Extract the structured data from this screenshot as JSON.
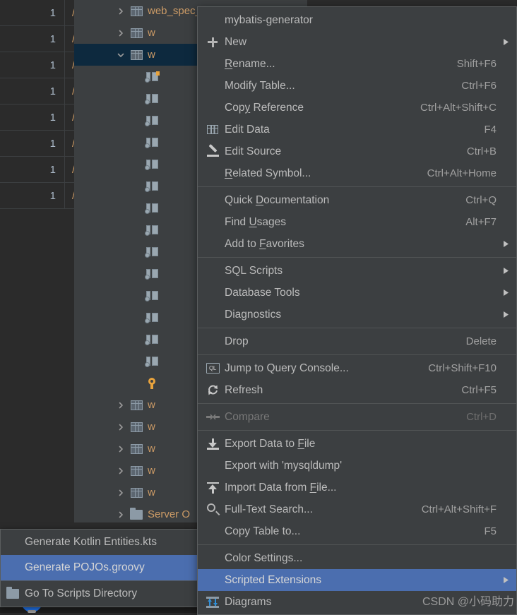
{
  "app": {
    "theme_bg": "#3c3f41",
    "editor_bg": "#2b2b2b",
    "highlight_blue": "#4b6eaf",
    "tree_selection_blue": "#0d293e",
    "text_color": "#bbbbbb",
    "accent_orange": "#cc9b66"
  },
  "grid": {
    "rows": [
      {
        "num": "1",
        "path": "/g"
      },
      {
        "num": "1",
        "path": "/m"
      },
      {
        "num": "1",
        "path": "/m"
      },
      {
        "num": "1",
        "path": "/m"
      },
      {
        "num": "1",
        "path": "/m"
      },
      {
        "num": "1",
        "path": "/m"
      },
      {
        "num": "1",
        "path": "/m"
      },
      {
        "num": "1",
        "path": "/m"
      }
    ]
  },
  "tree": {
    "rows": [
      {
        "indent": 0,
        "chevron": "right",
        "icon": "table-icon",
        "label": "web_spec_model"
      },
      {
        "indent": 0,
        "chevron": "right",
        "icon": "table-icon",
        "label": "w"
      },
      {
        "indent": 0,
        "chevron": "down",
        "icon": "table-icon",
        "label": "w",
        "selected": true
      },
      {
        "indent": 1,
        "chevron": "none",
        "icon": "column-pk-icon",
        "label": ""
      },
      {
        "indent": 1,
        "chevron": "none",
        "icon": "column-icon",
        "label": ""
      },
      {
        "indent": 1,
        "chevron": "none",
        "icon": "column-icon",
        "label": ""
      },
      {
        "indent": 1,
        "chevron": "none",
        "icon": "column-icon",
        "label": ""
      },
      {
        "indent": 1,
        "chevron": "none",
        "icon": "column-icon",
        "label": ""
      },
      {
        "indent": 1,
        "chevron": "none",
        "icon": "column-icon",
        "label": ""
      },
      {
        "indent": 1,
        "chevron": "none",
        "icon": "column-icon",
        "label": ""
      },
      {
        "indent": 1,
        "chevron": "none",
        "icon": "column-icon",
        "label": ""
      },
      {
        "indent": 1,
        "chevron": "none",
        "icon": "column-icon",
        "label": ""
      },
      {
        "indent": 1,
        "chevron": "none",
        "icon": "column-icon",
        "label": ""
      },
      {
        "indent": 1,
        "chevron": "none",
        "icon": "column-icon",
        "label": ""
      },
      {
        "indent": 1,
        "chevron": "none",
        "icon": "column-icon",
        "label": ""
      },
      {
        "indent": 1,
        "chevron": "none",
        "icon": "column-icon",
        "label": ""
      },
      {
        "indent": 1,
        "chevron": "none",
        "icon": "column-icon",
        "label": ""
      },
      {
        "indent": 1,
        "chevron": "none",
        "icon": "key-icon",
        "label": ""
      },
      {
        "indent": 0,
        "chevron": "right",
        "icon": "table-icon",
        "label": "w"
      },
      {
        "indent": 0,
        "chevron": "right",
        "icon": "table-icon",
        "label": "w"
      },
      {
        "indent": 0,
        "chevron": "right",
        "icon": "table-icon",
        "label": "w"
      },
      {
        "indent": 0,
        "chevron": "right",
        "icon": "table-icon",
        "label": "w"
      },
      {
        "indent": 0,
        "chevron": "right",
        "icon": "table-icon",
        "label": "w"
      },
      {
        "indent": 0,
        "chevron": "right",
        "icon": "folder-icon",
        "label": "Server O"
      }
    ]
  },
  "context_menu": {
    "items": [
      {
        "id": "mybatis-generator",
        "label": "mybatis-generator",
        "icon": "",
        "shortcut": "",
        "submenu": false
      },
      {
        "id": "new",
        "label": "New",
        "icon": "plus-icon",
        "shortcut": "",
        "submenu": true
      },
      {
        "id": "rename",
        "label": "Rename...",
        "icon": "",
        "shortcut": "Shift+F6",
        "mnemonic": "R",
        "submenu": false
      },
      {
        "id": "modify-table",
        "label": "Modify Table...",
        "icon": "",
        "shortcut": "Ctrl+F6",
        "submenu": false
      },
      {
        "id": "copy-reference",
        "label": "Copy Reference",
        "icon": "",
        "shortcut": "Ctrl+Alt+Shift+C",
        "mnemonic": "y",
        "submenu": false
      },
      {
        "id": "edit-data",
        "label": "Edit Data",
        "icon": "grid-icon",
        "shortcut": "F4",
        "submenu": false
      },
      {
        "id": "edit-source",
        "label": "Edit Source",
        "icon": "pencil-icon",
        "shortcut": "Ctrl+B",
        "submenu": false
      },
      {
        "id": "related-symbol",
        "label": "Related Symbol...",
        "icon": "",
        "shortcut": "Ctrl+Alt+Home",
        "mnemonic": "R",
        "submenu": false
      },
      {
        "id": "separator-1",
        "separator": true
      },
      {
        "id": "quick-documentation",
        "label": "Quick Documentation",
        "icon": "",
        "shortcut": "Ctrl+Q",
        "mnemonic": "D",
        "submenu": false
      },
      {
        "id": "find-usages",
        "label": "Find Usages",
        "icon": "",
        "shortcut": "Alt+F7",
        "mnemonic": "U",
        "submenu": false
      },
      {
        "id": "add-to-favorites",
        "label": "Add to Favorites",
        "icon": "",
        "shortcut": "",
        "mnemonic": "F",
        "submenu": true
      },
      {
        "id": "separator-2",
        "separator": true
      },
      {
        "id": "sql-scripts",
        "label": "SQL Scripts",
        "icon": "",
        "shortcut": "",
        "submenu": true
      },
      {
        "id": "database-tools",
        "label": "Database Tools",
        "icon": "",
        "shortcut": "",
        "submenu": true
      },
      {
        "id": "diagnostics",
        "label": "Diagnostics",
        "icon": "",
        "shortcut": "",
        "submenu": true
      },
      {
        "id": "separator-3",
        "separator": true
      },
      {
        "id": "drop",
        "label": "Drop",
        "icon": "",
        "shortcut": "Delete",
        "submenu": false
      },
      {
        "id": "separator-4",
        "separator": true
      },
      {
        "id": "jump-to-query-console",
        "label": "Jump to Query Console...",
        "icon": "ql-icon",
        "shortcut": "Ctrl+Shift+F10",
        "submenu": false
      },
      {
        "id": "refresh",
        "label": "Refresh",
        "icon": "refresh-icon",
        "shortcut": "Ctrl+F5",
        "submenu": false
      },
      {
        "id": "separator-5",
        "separator": true
      },
      {
        "id": "compare",
        "label": "Compare",
        "icon": "compare-icon",
        "shortcut": "Ctrl+D",
        "submenu": false,
        "disabled": true
      },
      {
        "id": "separator-6",
        "separator": true
      },
      {
        "id": "export-data-to-file",
        "label": "Export Data to File",
        "icon": "download-icon",
        "shortcut": "",
        "mnemonic": "F",
        "submenu": false
      },
      {
        "id": "export-with-mysqldump",
        "label": "Export with 'mysqldump'",
        "icon": "",
        "shortcut": "",
        "submenu": false
      },
      {
        "id": "import-data-from-file",
        "label": "Import Data from File...",
        "icon": "upload-icon",
        "shortcut": "",
        "mnemonic": "F",
        "submenu": false
      },
      {
        "id": "full-text-search",
        "label": "Full-Text Search...",
        "icon": "search-icon",
        "shortcut": "Ctrl+Alt+Shift+F",
        "submenu": false
      },
      {
        "id": "copy-table-to",
        "label": "Copy Table to...",
        "icon": "",
        "shortcut": "F5",
        "submenu": false
      },
      {
        "id": "separator-7",
        "separator": true
      },
      {
        "id": "color-settings",
        "label": "Color Settings...",
        "icon": "",
        "shortcut": "",
        "submenu": false
      },
      {
        "id": "scripted-extensions",
        "label": "Scripted Extensions",
        "icon": "",
        "shortcut": "",
        "submenu": true,
        "highlight": true
      },
      {
        "id": "diagrams",
        "label": "Diagrams",
        "icon": "diagram-icon",
        "shortcut": "",
        "submenu": false
      }
    ]
  },
  "submenu": {
    "title": "Scripted Extensions",
    "items": [
      {
        "id": "generate-kotlin-entities",
        "label": "Generate Kotlin Entities.kts",
        "icon": "",
        "highlight": false
      },
      {
        "id": "generate-pojos",
        "label": "Generate POJOs.groovy",
        "icon": "",
        "highlight": true
      },
      {
        "id": "separator",
        "separator": true
      },
      {
        "id": "go-to-scripts-directory",
        "label": "Go To Scripts Directory",
        "icon": "folder-icon",
        "highlight": false
      }
    ]
  },
  "watermark": {
    "text": "CSDN @小码助力"
  }
}
